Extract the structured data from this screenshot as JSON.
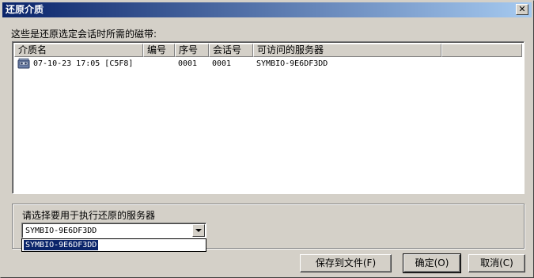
{
  "window": {
    "title": "还原介质",
    "close_label": "✕"
  },
  "prompt": "这些是还原选定会话时所需的磁带:",
  "table": {
    "columns": [
      "介质名",
      "编号",
      "序号",
      "会话号",
      "可访问的服务器"
    ],
    "rows": [
      {
        "name": "07-10-23 17:05 [C5F8]",
        "number": "",
        "sequence": "0001",
        "session": "0001",
        "server": "SYMBIO-9E6DF3DD",
        "icon": "tape-icon"
      }
    ]
  },
  "server_group": {
    "label": "请选择要用于执行还原的服务器",
    "selected": "SYMBIO-9E6DF3DD",
    "options": [
      "SYMBIO-9E6DF3DD"
    ]
  },
  "buttons": {
    "save_to_file": "保存到文件(F)",
    "ok": "确定(O)",
    "cancel": "取消(C)"
  },
  "colors": {
    "titlebar_start": "#0a246a",
    "titlebar_end": "#a6caf0",
    "dialog_bg": "#d4d0c8",
    "selection": "#0a246a"
  }
}
